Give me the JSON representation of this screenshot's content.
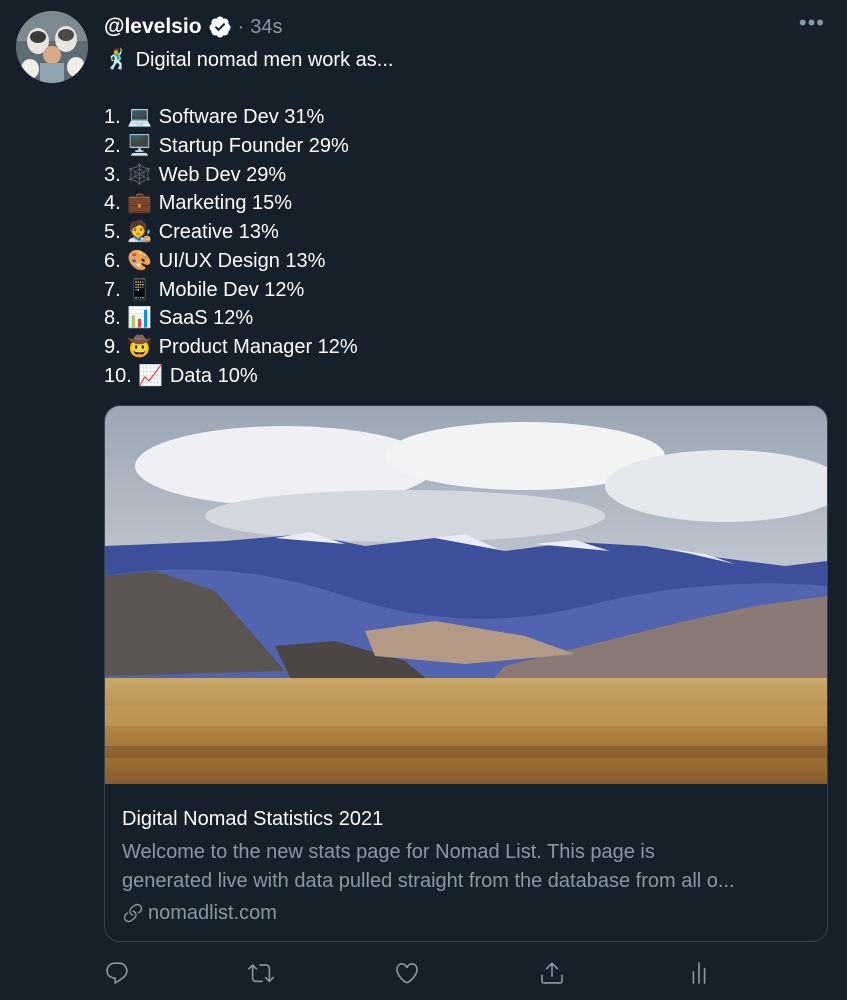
{
  "tweet": {
    "username": "@levelsio",
    "separator": "·",
    "time": "34s",
    "intro_emoji": "🕺",
    "intro": "Digital nomad men work as...",
    "list": [
      {
        "num": "1.",
        "emoji": "💻",
        "text": "Software Dev 31%"
      },
      {
        "num": "2.",
        "emoji": "🖥️",
        "text": "Startup Founder 29%"
      },
      {
        "num": "3.",
        "emoji": "🕸️",
        "text": "Web Dev 29%"
      },
      {
        "num": "4.",
        "emoji": "💼",
        "text": "Marketing 15%"
      },
      {
        "num": "5.",
        "emoji": "🧑‍🎨",
        "text": "Creative 13%"
      },
      {
        "num": "6.",
        "emoji": "🎨",
        "text": "UI/UX Design 13%"
      },
      {
        "num": "7.",
        "emoji": "📱",
        "text": "Mobile Dev 12%"
      },
      {
        "num": "8.",
        "emoji": "📊",
        "text": "SaaS 12%"
      },
      {
        "num": "9.",
        "emoji": "🤠",
        "text": "Product Manager 12%"
      },
      {
        "num": "10.",
        "emoji": "📈",
        "text": "Data 10%"
      }
    ]
  },
  "card": {
    "title": "Digital Nomad Statistics 2021",
    "description_line1": "Welcome to the new stats page for Nomad List. This page is",
    "description_line2": "generated live with data pulled straight from the database from all o...",
    "domain": "nomadlist.com"
  },
  "actions": {
    "reply_icon": "reply-icon",
    "retweet_icon": "retweet-icon",
    "like_icon": "heart-icon",
    "share_icon": "share-icon",
    "analytics_icon": "analytics-icon"
  },
  "colors": {
    "background": "#15202b",
    "secondary_text": "#8899a6",
    "border": "#38444d",
    "verified": "#ffffff"
  }
}
